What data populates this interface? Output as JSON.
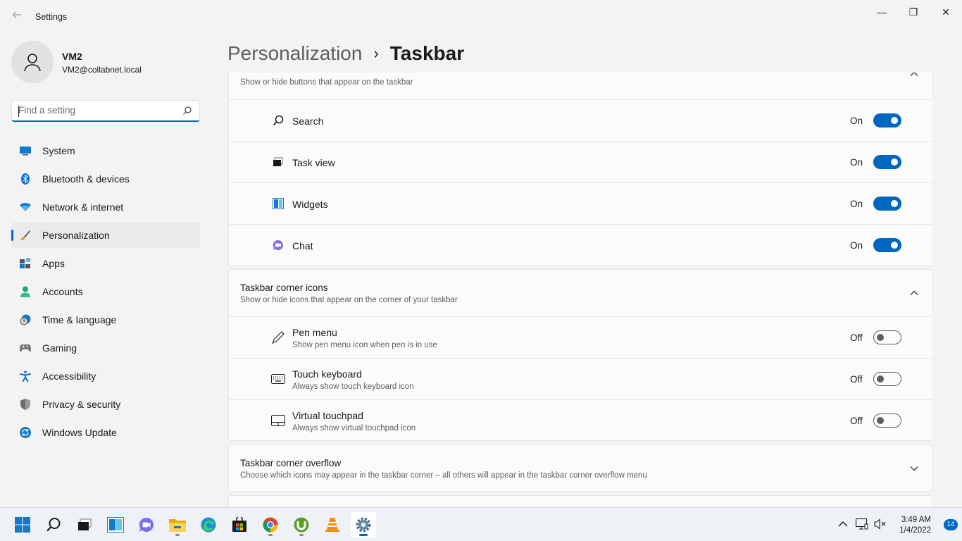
{
  "window": {
    "title": "Settings",
    "controls": {
      "minimize": "—",
      "maximize": "❐",
      "close": "✕"
    }
  },
  "user": {
    "name": "VM2",
    "email": "VM2@collabnet.local"
  },
  "search": {
    "placeholder": "Find a setting"
  },
  "sidebar": {
    "items": [
      {
        "label": "System",
        "icon": "monitor-icon"
      },
      {
        "label": "Bluetooth & devices",
        "icon": "bluetooth-icon"
      },
      {
        "label": "Network & internet",
        "icon": "wifi-icon"
      },
      {
        "label": "Personalization",
        "icon": "brush-icon",
        "active": true
      },
      {
        "label": "Apps",
        "icon": "apps-icon"
      },
      {
        "label": "Accounts",
        "icon": "person-icon"
      },
      {
        "label": "Time & language",
        "icon": "clock-globe-icon"
      },
      {
        "label": "Gaming",
        "icon": "gamepad-icon"
      },
      {
        "label": "Accessibility",
        "icon": "accessibility-icon"
      },
      {
        "label": "Privacy & security",
        "icon": "shield-icon"
      },
      {
        "label": "Windows Update",
        "icon": "update-icon"
      }
    ]
  },
  "header": {
    "parent": "Personalization",
    "separator": "›",
    "current": "Taskbar"
  },
  "taskbar_items": {
    "description": "Show or hide buttons that appear on the taskbar",
    "rows": [
      {
        "label": "Search",
        "state": "On",
        "on": true,
        "icon": "search-icon"
      },
      {
        "label": "Task view",
        "state": "On",
        "on": true,
        "icon": "task-view-icon"
      },
      {
        "label": "Widgets",
        "state": "On",
        "on": true,
        "icon": "widgets-icon"
      },
      {
        "label": "Chat",
        "state": "On",
        "on": true,
        "icon": "chat-icon"
      }
    ]
  },
  "corner_icons": {
    "title": "Taskbar corner icons",
    "description": "Show or hide icons that appear on the corner of your taskbar",
    "rows": [
      {
        "label": "Pen menu",
        "sub": "Show pen menu icon when pen is in use",
        "state": "Off",
        "on": false,
        "icon": "pen-icon"
      },
      {
        "label": "Touch keyboard",
        "sub": "Always show touch keyboard icon",
        "state": "Off",
        "on": false,
        "icon": "keyboard-icon"
      },
      {
        "label": "Virtual touchpad",
        "sub": "Always show virtual touchpad icon",
        "state": "Off",
        "on": false,
        "icon": "touchpad-icon"
      }
    ]
  },
  "corner_overflow": {
    "title": "Taskbar corner overflow",
    "description": "Choose which icons may appear in the taskbar corner – all others will appear in the taskbar corner overflow menu"
  },
  "system_taskbar": {
    "apps": [
      "start-icon",
      "search-icon",
      "task-view-icon",
      "widgets-icon",
      "chat-icon",
      "file-explorer-icon",
      "edge-icon",
      "store-icon",
      "chrome-icon",
      "utorrent-icon",
      "vlc-icon",
      "settings-icon"
    ],
    "time": "3:49 AM",
    "date": "1/4/2022",
    "notifications": "14"
  }
}
